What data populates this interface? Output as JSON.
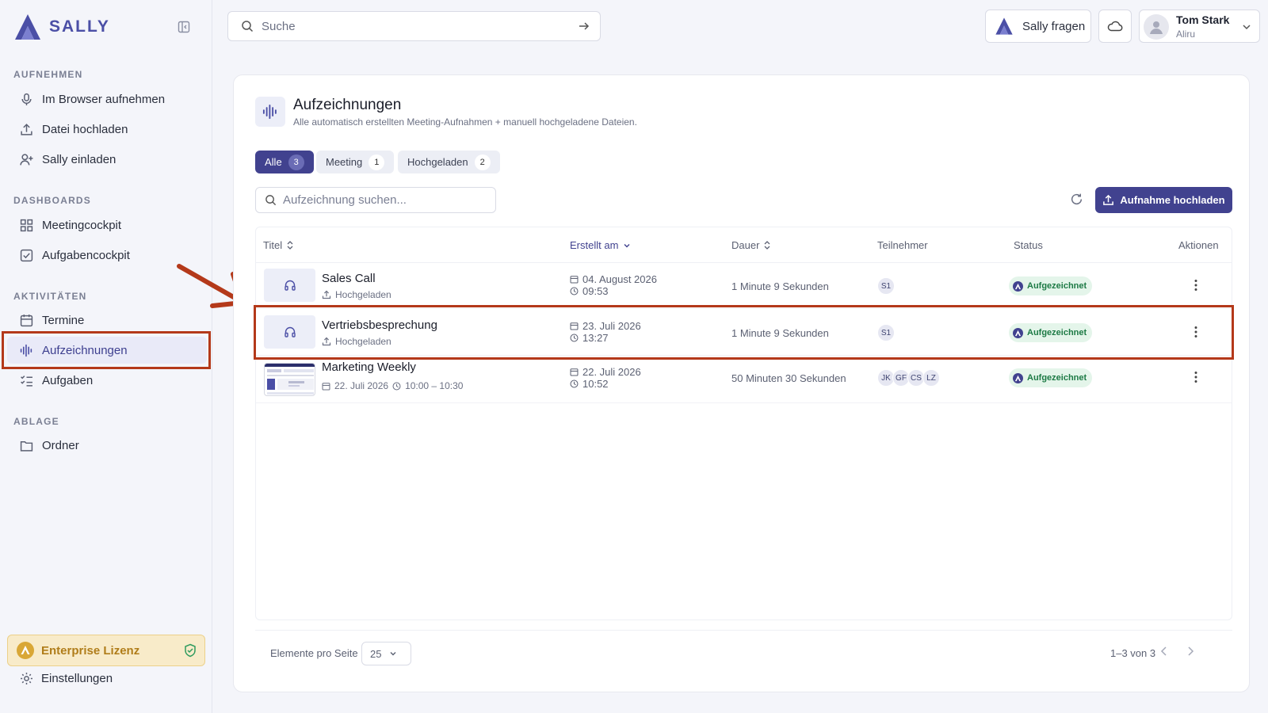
{
  "sidebar": {
    "brand": "SALLY",
    "sections": {
      "record": "AUFNEHMEN",
      "dashboards": "DASHBOARDS",
      "activities": "AKTIVITÄTEN",
      "storage": "ABLAGE"
    },
    "items": [
      {
        "label": "Im Browser aufnehmen",
        "icon": "microphone-icon"
      },
      {
        "label": "Datei hochladen",
        "icon": "upload-icon"
      },
      {
        "label": "Sally einladen",
        "icon": "user-plus-icon"
      },
      {
        "label": "Meetingcockpit",
        "icon": "grid-icon"
      },
      {
        "label": "Aufgabencockpit",
        "icon": "checkbox-icon"
      },
      {
        "label": "Termine",
        "icon": "calendar-icon"
      },
      {
        "label": "Aufzeichnungen",
        "icon": "waveform-icon",
        "active": true
      },
      {
        "label": "Aufgaben",
        "icon": "checklist-icon"
      },
      {
        "label": "Ordner",
        "icon": "folder-icon"
      }
    ],
    "license": "Enterprise Lizenz",
    "settings": "Einstellungen"
  },
  "topbar": {
    "search_placeholder": "Suche",
    "ask_label": "Sally fragen",
    "user_name": "Tom Stark",
    "user_org": "Aliru"
  },
  "main": {
    "title": "Aufzeichnungen",
    "subtitle": "Alle automatisch erstellten Meeting-Aufnahmen + manuell hochgeladene Dateien.",
    "filters": [
      {
        "label": "Alle",
        "count": "3",
        "active": true
      },
      {
        "label": "Meeting",
        "count": "1"
      },
      {
        "label": "Hochgeladen",
        "count": "2"
      }
    ],
    "search_placeholder": "Aufzeichnung suchen...",
    "upload_label": "Aufnahme hochladen",
    "columns": {
      "title": "Titel",
      "created": "Erstellt am",
      "duration": "Dauer",
      "participants": "Teilnehmer",
      "status": "Status",
      "actions": "Aktionen"
    },
    "rows": [
      {
        "title": "Sales Call",
        "sub": "Hochgeladen",
        "date": "04. August 2026",
        "time": "09:53",
        "duration": "1 Minute 9 Sekunden",
        "participants": [
          "S1"
        ],
        "status": "Aufgezeichnet"
      },
      {
        "title": "Vertriebsbesprechung",
        "sub": "Hochgeladen",
        "date": "23. Juli 2026",
        "time": "13:27",
        "duration": "1 Minute 9 Sekunden",
        "participants": [
          "S1"
        ],
        "status": "Aufgezeichnet"
      },
      {
        "title": "Marketing Weekly",
        "sub_date": "22. Juli 2026",
        "sub_time": "10:00 – 10:30",
        "date": "22. Juli 2026",
        "time": "10:52",
        "duration": "50 Minuten 30 Sekunden",
        "participants": [
          "JK",
          "GF",
          "CS",
          "LZ"
        ],
        "status": "Aufgezeichnet"
      }
    ],
    "pagination": {
      "per_page_label": "Elemente pro Seite",
      "per_page": "25",
      "range": "1–3 von 3"
    }
  },
  "colors": {
    "accent": "#41428f",
    "highlight": "#b4391a",
    "status_green": "#1d7a45"
  }
}
